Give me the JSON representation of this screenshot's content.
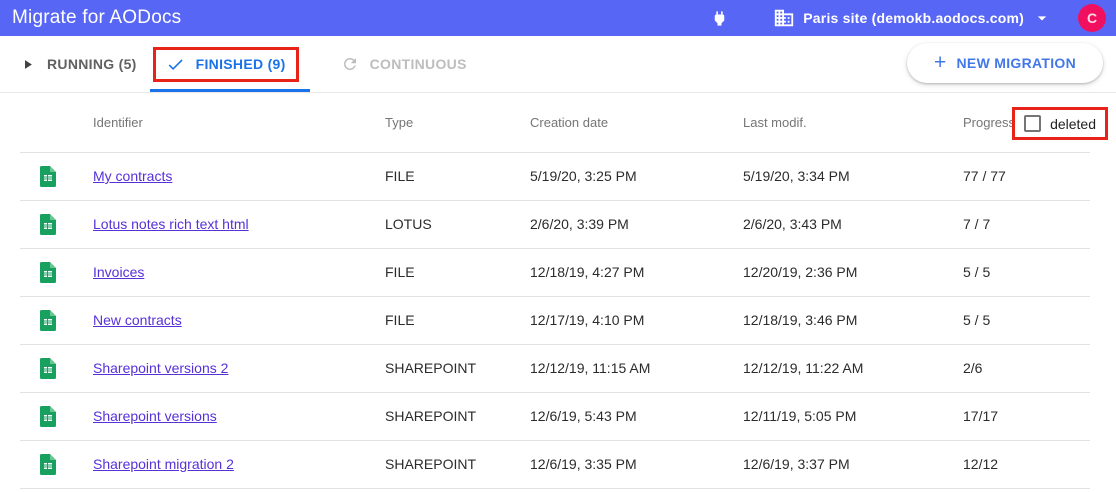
{
  "app": {
    "title": "Migrate for AODocs"
  },
  "header": {
    "site_label": "Paris site (demokb.aodocs.com)",
    "avatar_initial": "C"
  },
  "tabs": [
    {
      "label": "RUNNING (5)",
      "state": "inactive"
    },
    {
      "label": "FINISHED (9)",
      "state": "active"
    },
    {
      "label": "CONTINUOUS",
      "state": "disabled"
    }
  ],
  "toolbar": {
    "new_migration_label": "NEW MIGRATION"
  },
  "filters": {
    "deleted_label": "deleted",
    "deleted_checked": false
  },
  "icons": {
    "plus": "+",
    "plug": "power-plug-icon",
    "building": "domain-building-icon",
    "dropdown": "arrow-drop-down-icon",
    "play": "play-arrow-icon",
    "check": "check-icon",
    "refresh": "refresh-icon",
    "spreadsheet": "green-spreadsheet-file-icon"
  },
  "colors": {
    "header_bg": "#5866f5",
    "accent_blue": "#1a73e8",
    "button_blue": "#4377e8",
    "link_purple": "#5531d8",
    "avatar_pink": "#f1105f",
    "annotation_red": "#e8231a",
    "sheet_green": "#17a05e"
  },
  "table": {
    "columns": [
      "Identifier",
      "Type",
      "Creation date",
      "Last modif.",
      "Progress"
    ],
    "rows": [
      {
        "identifier": "My contracts",
        "type": "FILE",
        "creation": "5/19/20, 3:25 PM",
        "modified": "5/19/20, 3:34 PM",
        "progress": "77 / 77"
      },
      {
        "identifier": "Lotus notes rich text html",
        "type": "LOTUS",
        "creation": "2/6/20, 3:39 PM",
        "modified": "2/6/20, 3:43 PM",
        "progress": "7 / 7"
      },
      {
        "identifier": "Invoices",
        "type": "FILE",
        "creation": "12/18/19, 4:27 PM",
        "modified": "12/20/19, 2:36 PM",
        "progress": "5 / 5"
      },
      {
        "identifier": "New contracts",
        "type": "FILE",
        "creation": "12/17/19, 4:10 PM",
        "modified": "12/18/19, 3:46 PM",
        "progress": "5 / 5"
      },
      {
        "identifier": "Sharepoint versions 2",
        "type": "SHAREPOINT",
        "creation": "12/12/19, 11:15 AM",
        "modified": "12/12/19, 11:22 AM",
        "progress": "2/6"
      },
      {
        "identifier": "Sharepoint versions",
        "type": "SHAREPOINT",
        "creation": "12/6/19, 5:43 PM",
        "modified": "12/11/19, 5:05 PM",
        "progress": "17/17"
      },
      {
        "identifier": "Sharepoint migration 2",
        "type": "SHAREPOINT",
        "creation": "12/6/19, 3:35 PM",
        "modified": "12/6/19, 3:37 PM",
        "progress": "12/12"
      }
    ]
  }
}
